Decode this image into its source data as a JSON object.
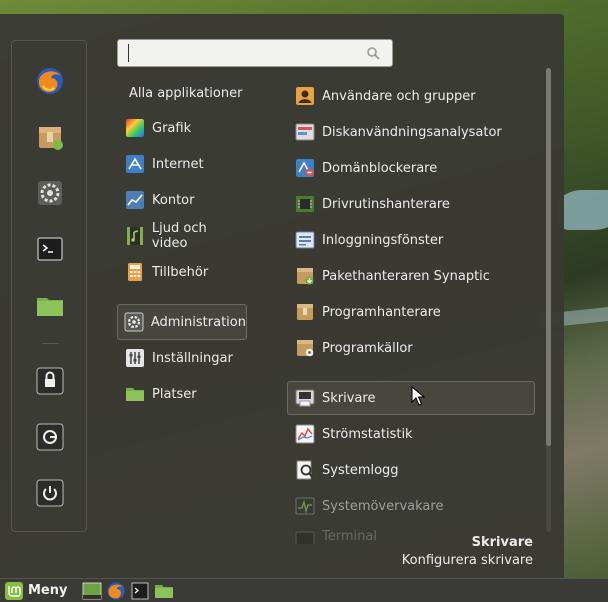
{
  "search": {
    "value": "",
    "placeholder": ""
  },
  "categories_all_label": "Alla applikationer",
  "categories": [
    {
      "label": "Grafik",
      "icon": "graphics-icon"
    },
    {
      "label": "Internet",
      "icon": "internet-icon"
    },
    {
      "label": "Kontor",
      "icon": "office-icon"
    },
    {
      "label": "Ljud och video",
      "icon": "multimedia-icon"
    },
    {
      "label": "Tillbehör",
      "icon": "accessories-icon"
    },
    {
      "label": "Administration",
      "icon": "administration-icon",
      "selected": true
    },
    {
      "label": "Inställningar",
      "icon": "settings-icon"
    },
    {
      "label": "Platser",
      "icon": "folder-icon"
    }
  ],
  "apps": [
    {
      "label": "Användare och grupper",
      "icon": "users-icon"
    },
    {
      "label": "Diskanvändningsanalysator",
      "icon": "disk-usage-icon"
    },
    {
      "label": "Domänblockerare",
      "icon": "domain-blocker-icon"
    },
    {
      "label": "Drivrutinshanterare",
      "icon": "driver-manager-icon"
    },
    {
      "label": "Inloggningsfönster",
      "icon": "login-window-icon"
    },
    {
      "label": "Pakethanteraren Synaptic",
      "icon": "synaptic-icon"
    },
    {
      "label": "Programhanterare",
      "icon": "software-manager-icon"
    },
    {
      "label": "Programkällor",
      "icon": "software-sources-icon"
    },
    {
      "label": "Skrivare",
      "icon": "printer-icon",
      "selected": true
    },
    {
      "label": "Strömstatistik",
      "icon": "power-statistics-icon"
    },
    {
      "label": "Systemlogg",
      "icon": "system-log-icon"
    },
    {
      "label": "Systemövervakare",
      "icon": "system-monitor-icon"
    },
    {
      "label": "Terminal",
      "icon": "terminal-icon"
    }
  ],
  "description": {
    "title": "Skrivare",
    "text": "Konfigurera skrivare"
  },
  "favorites": [
    "firefox-icon",
    "software-manager-icon",
    "settings-gear-icon",
    "terminal-icon",
    "folder-icon",
    "lock-screen-icon",
    "logout-icon",
    "shutdown-icon"
  ],
  "taskbar": {
    "menu_label": "Meny"
  },
  "colors": {
    "menu_bg": "#3a3a34",
    "selection_border": "#6a6a62",
    "text": "#ececec"
  }
}
